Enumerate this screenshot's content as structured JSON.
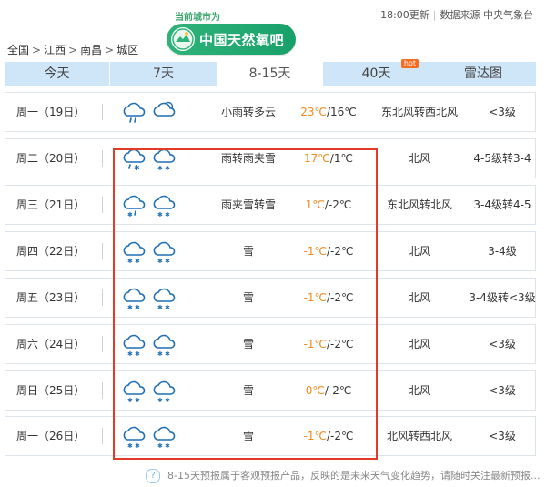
{
  "header": {
    "update_time": "18:00更新",
    "source": "数据来源 中央气象台",
    "banner_subtitle": "当前城市为",
    "banner_title": "中国天然氧吧"
  },
  "breadcrumb": {
    "items": [
      "全国",
      "江西",
      "南昌",
      "城区"
    ],
    "separator": ">"
  },
  "tabs": [
    {
      "label": "今天",
      "active": false
    },
    {
      "label": "7天",
      "active": false
    },
    {
      "label": "8-15天",
      "active": true
    },
    {
      "label": "40天",
      "active": false,
      "badge": "hot"
    },
    {
      "label": "雷达图",
      "active": false
    }
  ],
  "forecast": [
    {
      "date": "周一（19日）",
      "icon_day": "light-rain-icon",
      "icon_night": "cloudy-icon",
      "desc": "小雨转多云",
      "high": "23℃",
      "low": "16℃",
      "wind": "东北风转西北风",
      "level": "<3级"
    },
    {
      "date": "周二（20日）",
      "icon_day": "rain-snow-icon",
      "icon_night": "snow-icon",
      "desc": "雨转雨夹雪",
      "high": "17℃",
      "low": "1℃",
      "wind": "北风",
      "level": "4-5级转3-4"
    },
    {
      "date": "周三（21日）",
      "icon_day": "sleet-icon",
      "icon_night": "snow-icon",
      "desc": "雨夹雪转雪",
      "high": "1℃",
      "low": "-2℃",
      "wind": "东北风转北风",
      "level": "3-4级转4-5"
    },
    {
      "date": "周四（22日）",
      "icon_day": "snow-icon",
      "icon_night": "snow-icon",
      "desc": "雪",
      "high": "-1℃",
      "low": "-2℃",
      "wind": "北风",
      "level": "3-4级"
    },
    {
      "date": "周五（23日）",
      "icon_day": "snow-icon",
      "icon_night": "snow-icon",
      "desc": "雪",
      "high": "-1℃",
      "low": "-2℃",
      "wind": "北风",
      "level": "3-4级转<3级"
    },
    {
      "date": "周六（24日）",
      "icon_day": "snow-icon",
      "icon_night": "snow-icon",
      "desc": "雪",
      "high": "-1℃",
      "low": "-2℃",
      "wind": "北风",
      "level": "<3级"
    },
    {
      "date": "周日（25日）",
      "icon_day": "snow-icon",
      "icon_night": "snow-icon",
      "desc": "雪",
      "high": "0℃",
      "low": "-2℃",
      "wind": "北风",
      "level": "<3级"
    },
    {
      "date": "周一（26日）",
      "icon_day": "snow-icon",
      "icon_night": "snow-icon",
      "desc": "雪",
      "high": "-1℃",
      "low": "-2℃",
      "wind": "北风转西北风",
      "level": "<3级"
    }
  ],
  "footer": {
    "help_icon": "question-icon",
    "note": "8-15天预报属于客观预报产品，反映的是未来天气变化趋势，请随时关注最新预报..."
  },
  "colors": {
    "high_temp": "#f08a1d",
    "highlight_box": "#e33b26",
    "tab_bg": "#cfe5f8",
    "brand_green": "#2fb37a"
  }
}
